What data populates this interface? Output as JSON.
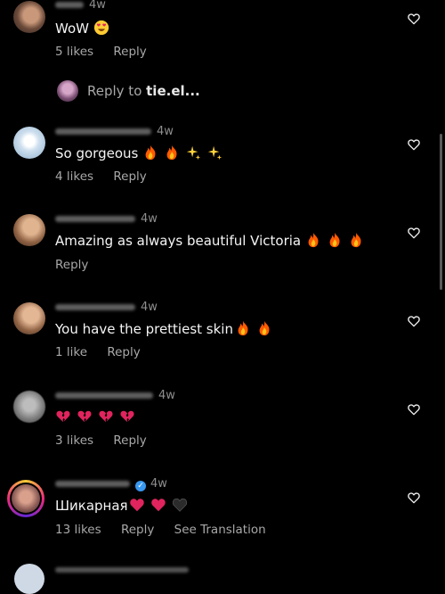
{
  "comments": [
    {
      "time": "4w",
      "text": "WoW",
      "likes": "5 likes",
      "reply": "Reply",
      "emojis": [
        "smile-heart-eyes"
      ]
    },
    {
      "time": "4w",
      "text": "So gorgeous",
      "likes": "4 likes",
      "reply": "Reply",
      "emojis": [
        "fire",
        "fire",
        "sparkles",
        "sparkles"
      ]
    },
    {
      "time": "4w",
      "text": "Amazing as always beautiful Victoria",
      "reply": "Reply",
      "emojis": [
        "fire",
        "fire",
        "fire"
      ]
    },
    {
      "time": "4w",
      "text": "You have the prettiest skin",
      "likes": "1 like",
      "reply": "Reply",
      "emojis": [
        "fire",
        "fire"
      ]
    },
    {
      "time": "4w",
      "text": "",
      "likes": "3 likes",
      "reply": "Reply",
      "emojis": [
        "broken-heart",
        "broken-heart",
        "broken-heart",
        "broken-heart"
      ]
    },
    {
      "time": "4w",
      "text": "Шикарная",
      "likes": "13 likes",
      "reply": "Reply",
      "see_translation": "See Translation",
      "verified": true,
      "emojis": [
        "red-heart",
        "red-heart",
        "black-heart"
      ]
    }
  ],
  "reply_bar": {
    "prefix": "Reply to ",
    "target": "tie.el..."
  },
  "colors": {
    "background": "#000000",
    "text": "#f5f5f5",
    "muted": "#8e8e8e",
    "verified": "#3897f0",
    "fire": "#ff6a00",
    "heart_red": "#e0245e"
  }
}
